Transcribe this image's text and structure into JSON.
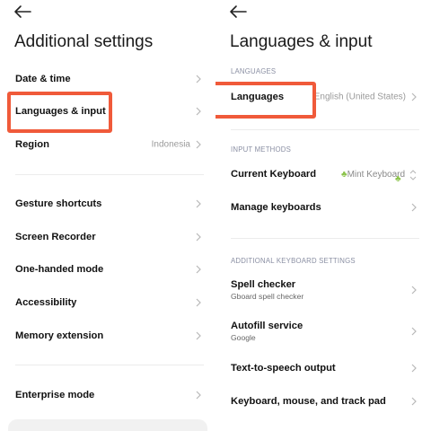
{
  "left": {
    "title": "Additional settings",
    "items": [
      {
        "label": "Date & time"
      },
      {
        "label": "Languages & input"
      },
      {
        "label": "Region",
        "value": "Indonesia"
      },
      {
        "label": "Gesture shortcuts"
      },
      {
        "label": "Screen Recorder"
      },
      {
        "label": "One-handed mode"
      },
      {
        "label": "Accessibility"
      },
      {
        "label": "Memory extension"
      },
      {
        "label": "Enterprise mode"
      }
    ]
  },
  "right": {
    "title": "Languages & input",
    "sections": {
      "languages": "LANGUAGES",
      "input_methods": "INPUT METHODS",
      "additional_keyboard": "ADDITIONAL KEYBOARD SETTINGS"
    },
    "items": {
      "languages": {
        "label": "Languages",
        "value": "English (United States)"
      },
      "current_keyboard": {
        "label": "Current Keyboard",
        "value": "Mint Keyboard"
      },
      "manage_keyboards": {
        "label": "Manage keyboards"
      },
      "spell_checker": {
        "label": "Spell checker",
        "sub": "Gboard spell checker"
      },
      "autofill": {
        "label": "Autofill service",
        "sub": "Google"
      },
      "tts": {
        "label": "Text-to-speech output"
      },
      "keyboard_mouse": {
        "label": "Keyboard, mouse, and track pad"
      }
    }
  },
  "colors": {
    "highlight": "#f05a3a",
    "section_header": "#8a8fa3",
    "clover": "#8bc34a"
  }
}
